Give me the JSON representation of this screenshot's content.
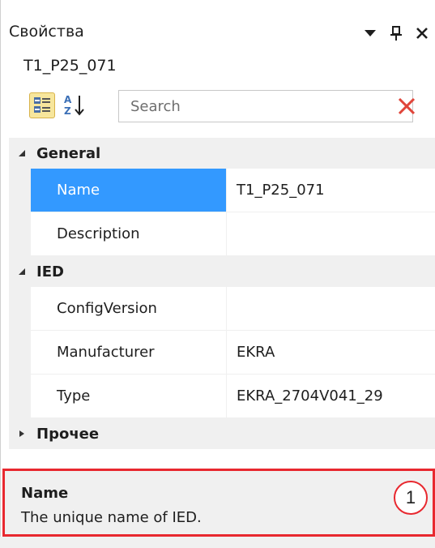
{
  "header": {
    "title": "Свойства",
    "icons": [
      "dropdown-arrow-icon",
      "pin-icon",
      "close-icon"
    ]
  },
  "subject": "T1_P25_071",
  "toolbar": {
    "categorized_icon": "categorized-view-icon",
    "alphabetical_icon": "sort-alphabetical-icon",
    "search_placeholder": "Search",
    "clear_icon": "clear-search-icon"
  },
  "grid": {
    "categories": [
      {
        "label": "General",
        "expanded": true,
        "properties": [
          {
            "name": "Name",
            "value": "T1_P25_071",
            "selected": true
          },
          {
            "name": "Description",
            "value": ""
          }
        ]
      },
      {
        "label": "IED",
        "expanded": true,
        "properties": [
          {
            "name": "ConfigVersion",
            "value": ""
          },
          {
            "name": "Manufacturer",
            "value": "EKRA"
          },
          {
            "name": "Type",
            "value": "EKRA_2704V041_29"
          }
        ]
      },
      {
        "label": "Прочее",
        "expanded": false,
        "properties": []
      }
    ]
  },
  "description": {
    "title": "Name",
    "text": "The unique name of IED."
  },
  "callout": "1",
  "colors": {
    "selection": "#3399ff",
    "callout_border": "#e8282f",
    "category_bg": "#f0f0f0",
    "clear_icon": "#e0453a"
  }
}
